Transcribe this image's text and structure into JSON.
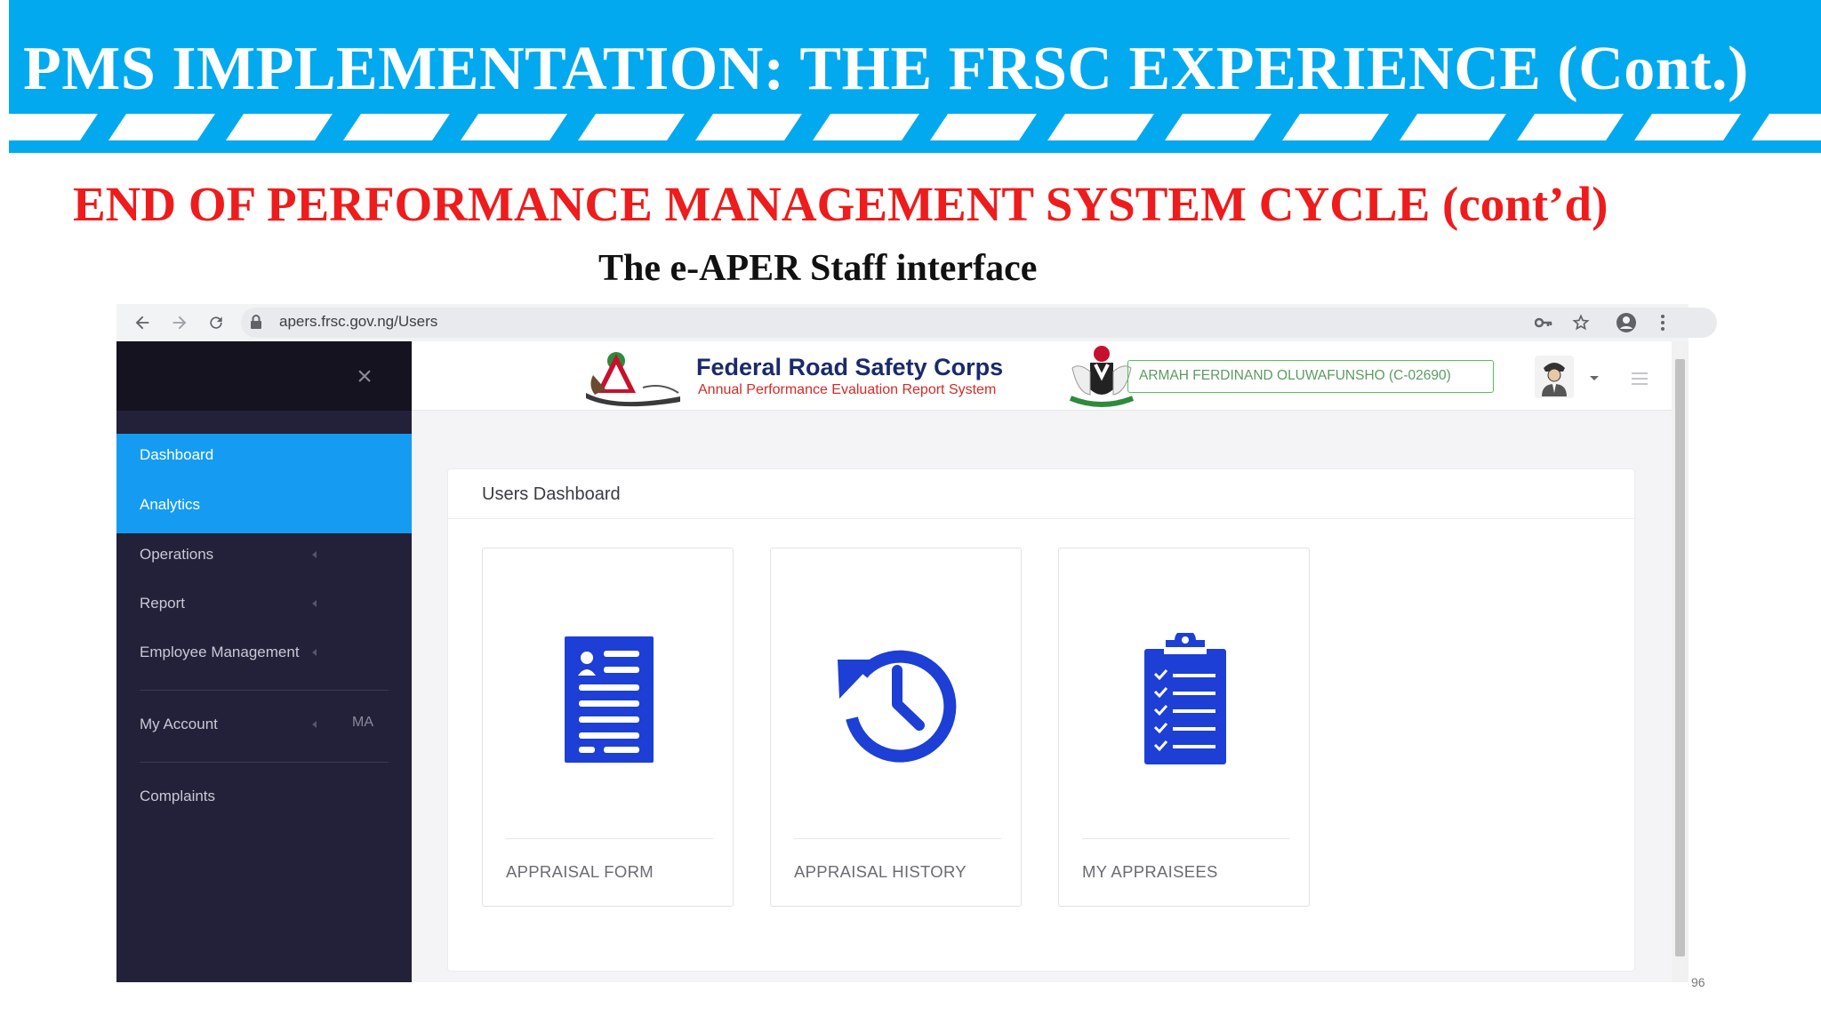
{
  "slide": {
    "title": "PMS IMPLEMENTATION: THE FRSC EXPERIENCE (Cont.)",
    "subtitle": "END OF PERFORMANCE MANAGEMENT SYSTEM CYCLE (cont’d)",
    "caption": "The e-APER Staff interface",
    "page_number": "96"
  },
  "browser": {
    "url": "apers.frsc.gov.ng/Users",
    "back_icon": "arrow-left-icon",
    "forward_icon": "arrow-right-icon",
    "reload_icon": "reload-icon",
    "lock_icon": "lock-icon",
    "key_icon": "key-icon",
    "star_icon": "star-icon",
    "profile_icon": "account-circle-icon",
    "menu_icon": "more-vertical-icon"
  },
  "app": {
    "brand_title": "Federal Road Safety Corps",
    "brand_subtitle": "Annual Performance Evaluation Report System",
    "user_label": "ARMAH FERDINAND OLUWAFUNSHO (C-02690)"
  },
  "sidebar": {
    "items": [
      {
        "label": "Dashboard",
        "active": true
      },
      {
        "label": "Analytics",
        "active": true
      },
      {
        "label": "Operations"
      },
      {
        "label": "Report"
      },
      {
        "label": "Employee Management"
      },
      {
        "label": "My Account",
        "badge": "MA"
      },
      {
        "label": "Complaints"
      }
    ]
  },
  "panel": {
    "title": "Users Dashboard",
    "cards": [
      {
        "label": "APPRAISAL FORM",
        "icon": "form-document-icon"
      },
      {
        "label": "APPRAISAL HISTORY",
        "icon": "history-clock-icon"
      },
      {
        "label": "MY APPRAISEES",
        "icon": "clipboard-checklist-icon"
      }
    ]
  },
  "colors": {
    "banner": "#03a9ee",
    "subtitle_red": "#ee1c1c",
    "sidebar_bg": "#23203a",
    "sidebar_active": "#159cf2",
    "icon_blue": "#1d3fd6",
    "user_box_green": "#4fc35c"
  }
}
